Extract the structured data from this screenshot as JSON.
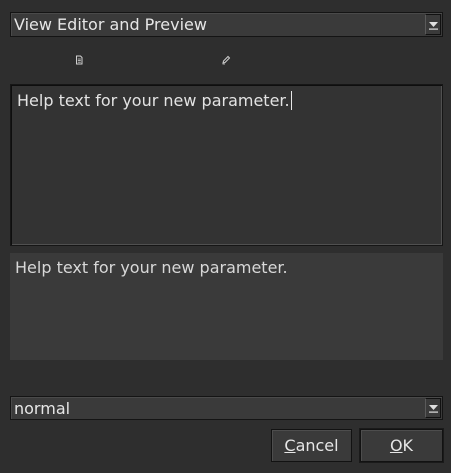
{
  "view_mode": {
    "selected": "View Editor and Preview"
  },
  "toolbar": {
    "icons": [
      "file-icon",
      "edit-icon"
    ]
  },
  "editor": {
    "value": "Help text for your new parameter."
  },
  "preview": {
    "text": "Help text for your new parameter."
  },
  "severity": {
    "selected": "normal"
  },
  "buttons": {
    "cancel_mnemonic": "C",
    "cancel_rest": "ancel",
    "ok_mnemonic": "O",
    "ok_rest": "K"
  },
  "colors": {
    "background": "#2e2e2e",
    "field": "#3a3a3a",
    "editor_field": "#333333",
    "text": "#e0e0e0"
  }
}
